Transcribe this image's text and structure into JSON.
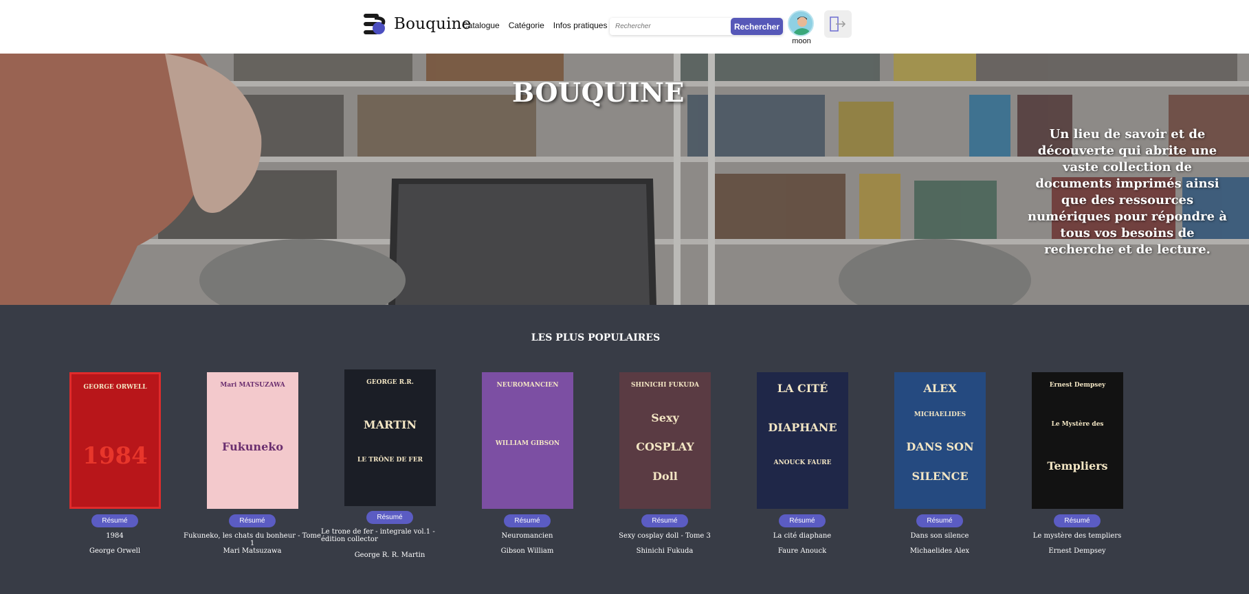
{
  "header": {
    "logo_text": "Bouquine",
    "nav": [
      "Catalogue",
      "Catégorie",
      "Infos pratiques"
    ],
    "search_placeholder": "Rechercher",
    "search_button": "Rechercher",
    "user_name": "moon"
  },
  "hero": {
    "title": "BOUQUINE",
    "text": "Un lieu de savoir et de découverte qui abrite une vaste collection de documents imprimés ainsi que des ressources numériques pour répondre à tous vos besoins de recherche et de lecture."
  },
  "popular": {
    "title": "LES PLUS POPULAIRES",
    "resume_label": "Résumé",
    "books": [
      {
        "title": "1984",
        "author": "George Orwell",
        "cover_color": "#b8161a",
        "cover_lines": [
          "GEORGE ORWELL",
          "1984"
        ]
      },
      {
        "title": "Fukuneko, les chats du bonheur - Tome 1",
        "author": "Mari Matsuzawa",
        "cover_color": "#f3c9cc",
        "cover_lines": [
          "Mari MATSUZAWA",
          "Fukuneko"
        ]
      },
      {
        "title": "Le trone de fer - integrale vol.1 - édition collector",
        "author": "George R. R. Martin",
        "cover_color": "#1b1e26",
        "cover_lines": [
          "GEORGE R.R.",
          "MARTIN",
          "LE TRÔNE DE FER"
        ]
      },
      {
        "title": "Neuromancien",
        "author": "Gibson William",
        "cover_color": "#7c4fa3",
        "cover_lines": [
          "NEUROMANCIEN",
          "WILLIAM GIBSON"
        ]
      },
      {
        "title": "Sexy cosplay doll - Tome 3",
        "author": "Shinichi Fukuda",
        "cover_color": "#5a3b43",
        "cover_lines": [
          "SHINICHI FUKUDA",
          "Sexy",
          "COSPLAY",
          "Doll"
        ]
      },
      {
        "title": "La cité diaphane",
        "author": "Faure Anouck",
        "cover_color": "#1f2748",
        "cover_lines": [
          "LA CITÉ",
          "DIAPHANE",
          "ANOUCK FAURE"
        ]
      },
      {
        "title": "Dans son silence",
        "author": "Michaelides Alex",
        "cover_color": "#254a80",
        "cover_lines": [
          "ALEX",
          "MICHAELIDES",
          "DANS SON",
          "SILENCE"
        ]
      },
      {
        "title": "Le mystère des templiers",
        "author": "Ernest Dempsey",
        "cover_color": "#121212",
        "cover_lines": [
          "Ernest Dempsey",
          "Le Mystère des",
          "Templiers"
        ]
      }
    ]
  },
  "colors": {
    "accent": "#5658b8",
    "section_bg": "#383c46"
  }
}
